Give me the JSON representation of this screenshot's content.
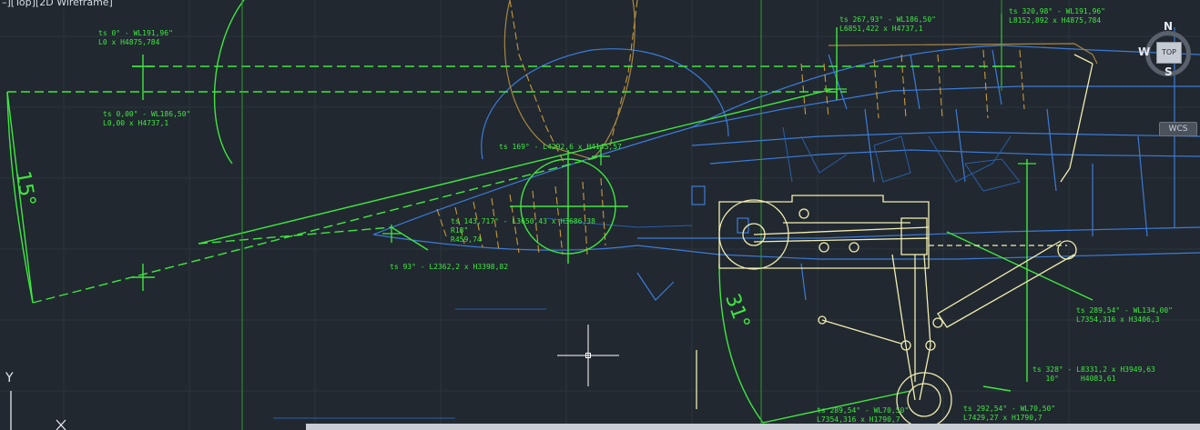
{
  "viewport": {
    "label": "–][Top][2D Wireframe]"
  },
  "viewcube": {
    "top": "TOP",
    "north": "N",
    "south": "S",
    "west": "W",
    "wcs": "WCS"
  },
  "ucs": {
    "y": "Y"
  },
  "angles": {
    "a15": "15°",
    "a31": "31°"
  },
  "annotations": {
    "n1": "ts 0° - WL191,96\"\nL0 x H4875,784",
    "n2": "ts 0,00° - WL186,50\"\nL0,00 x H4737,1",
    "n3": "ts 267,93° - WL186,50\"\nL6851,422 x H4737,1",
    "n4": "ts 320,98° - WL191,96\"\nL8152,892 x H4875,784",
    "n5": "ts 169° - L4292,6 x H4145,57",
    "n6": "ts 143,717° - L3650,43 x H3686,38\nR18\"\nR459,74",
    "n7": "ts 93° - L2362,2 x H3398,82",
    "n8": "ts 289,54° - WL134,00\"\nL7354,316 x H3406,3",
    "n9": "ts 328° - L8331,2 x H3949,63\n   10°     H4083,61",
    "n10": "ts 289,54° - WL70,50\"\nL7354,316 x H1790,7",
    "n11": "ts 292,54° - WL70,50\"\nL7429,27 x H1790,7"
  },
  "colors": {
    "background": "#212830",
    "construction": "#3fe83f",
    "fuselage": "#3c7bd8",
    "gear": "#f1eeb0",
    "hatch": "#c79a3b"
  }
}
